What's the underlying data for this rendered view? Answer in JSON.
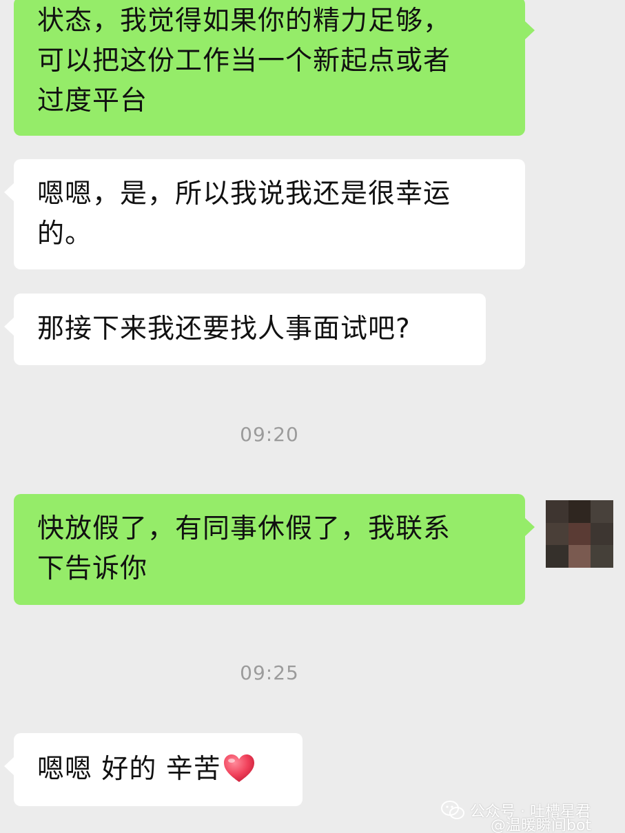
{
  "messages": [
    {
      "direction": "out",
      "text": "状态，我觉得如果你的精力足够，\n可以把这份工作当一个新起点或者\n过度平台"
    },
    {
      "direction": "in",
      "text": "嗯嗯，是，所以我说我还是很幸运\n的。"
    },
    {
      "direction": "in",
      "text": "那接下来我还要找人事面试吧?"
    },
    {
      "direction": "out",
      "text": "快放假了，有同事休假了，我联系\n下告诉你"
    },
    {
      "direction": "in",
      "text": "嗯嗯 好的 辛苦"
    }
  ],
  "timestamps": [
    "09:20",
    "09:25"
  ],
  "icons": {
    "heart": "heart-emoji-icon",
    "avatar": "pixelated-avatar",
    "watermark_logo": "wechat-logo-icon"
  },
  "colors": {
    "background": "#ececec",
    "incoming_bubble": "#ffffff",
    "outgoing_bubble": "#95ec69",
    "timestamp": "#9b9b9b",
    "heart": "#f0405a"
  },
  "watermark": {
    "line1": "公众号 · 吐槽星君",
    "line2": "@温暖瞬间bot"
  }
}
